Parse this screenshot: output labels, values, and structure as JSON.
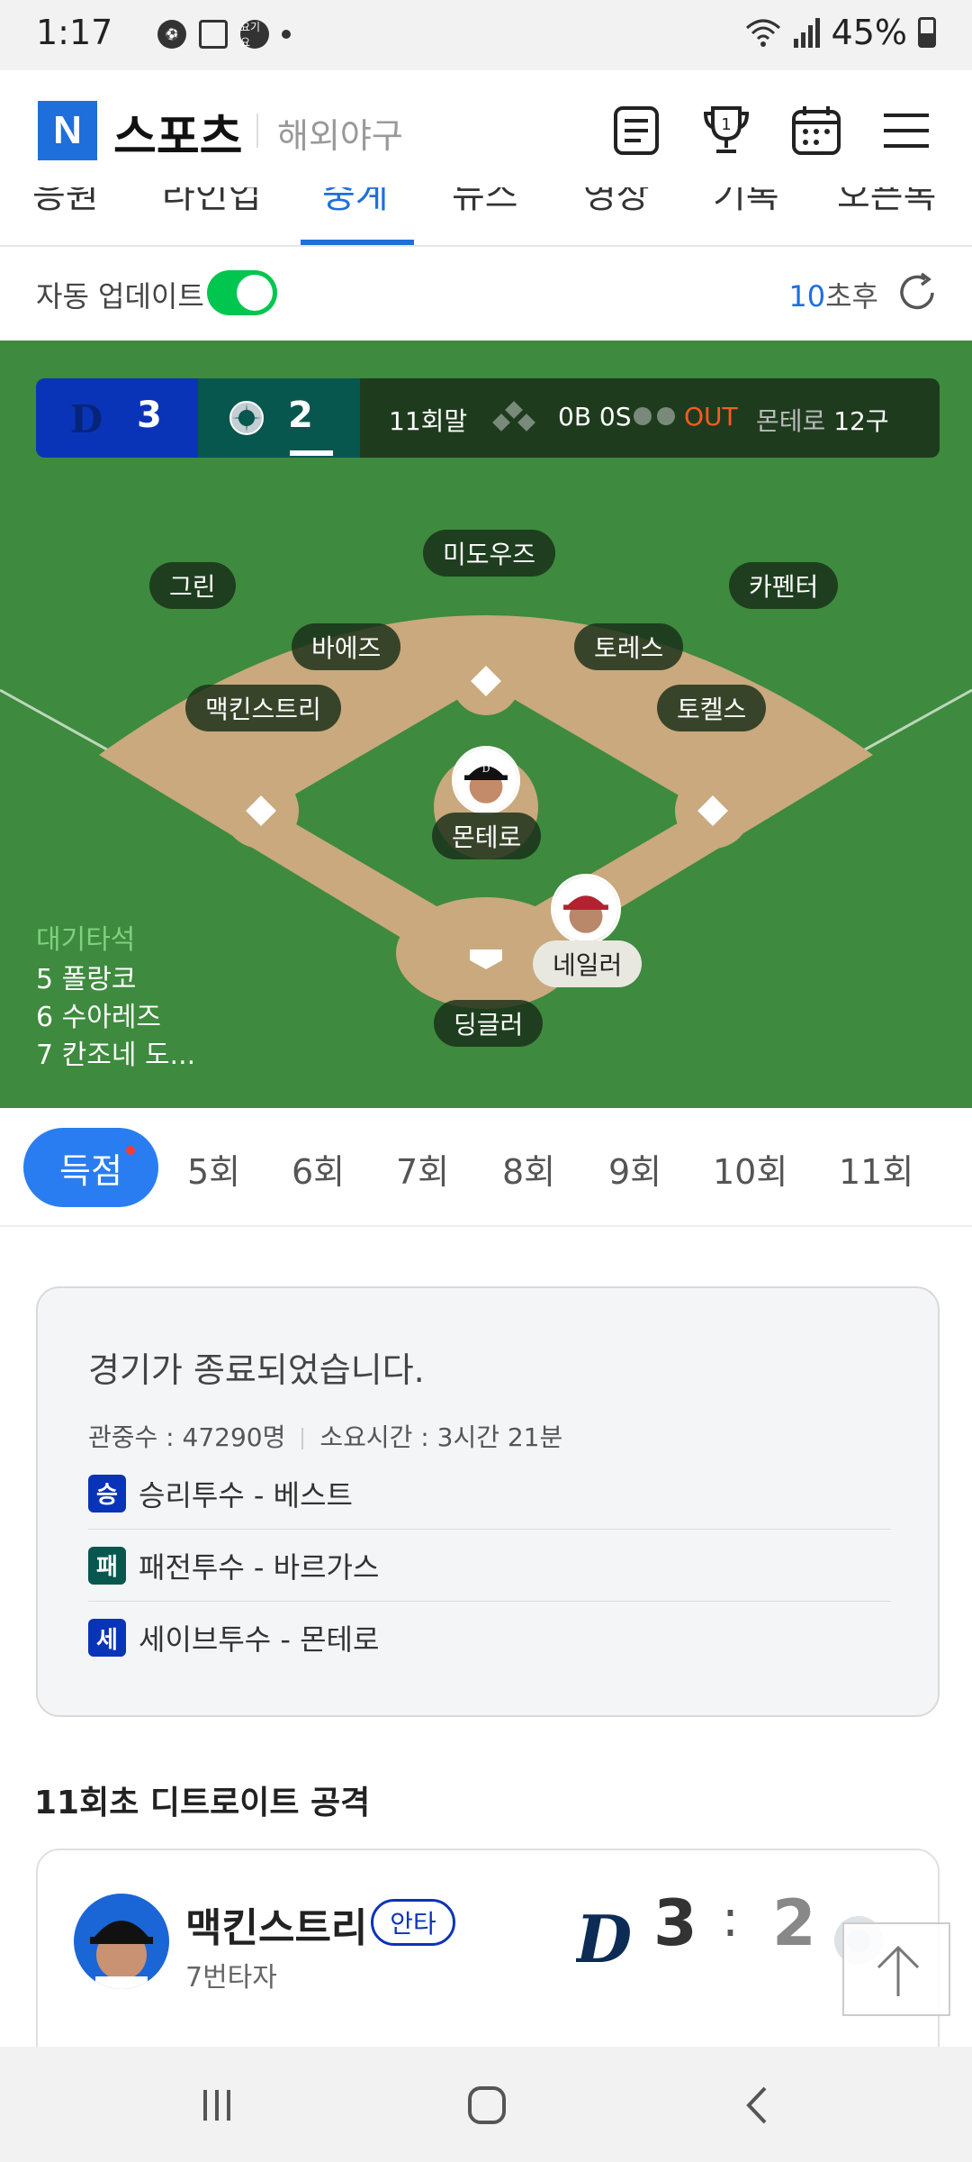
{
  "status_bar": {
    "time": "1:17",
    "notif_badge": "요기요",
    "battery": "45%"
  },
  "header": {
    "logo_letter": "N",
    "logo_text": "스포츠",
    "section": "해외야구"
  },
  "tabs": [
    {
      "label": "응원"
    },
    {
      "label": "라인업"
    },
    {
      "label": "중계",
      "active": true
    },
    {
      "label": "뉴스"
    },
    {
      "label": "영상"
    },
    {
      "label": "기록"
    },
    {
      "label": "오픈톡"
    }
  ],
  "auto_update": {
    "label": "자동 업데이트",
    "enabled": true,
    "countdown_num": "10",
    "countdown_unit": "초후"
  },
  "scoreboard": {
    "away": {
      "team_icon": "detroit-tigers-logo-icon",
      "score": "3",
      "color": "#0a34b8"
    },
    "home": {
      "team_icon": "seattle-mariners-logo-icon",
      "score": "2",
      "color": "#07574f"
    },
    "inning": "11회말",
    "count": "0B 0S",
    "out_label": "OUT",
    "pitcher_name": "몬테로",
    "pitch_count": "12구"
  },
  "field": {
    "positions": {
      "cf": "미도우즈",
      "lf": "그린",
      "rf": "카펜터",
      "ss": "바에즈",
      "b2": "토레스",
      "b3": "맥킨스트리",
      "b1": "토켈스",
      "pitcher": "몬테로",
      "catcher": "딩글러",
      "batter": "네일러"
    },
    "bench": {
      "title": "대기타석",
      "items": [
        "5 폴랑코",
        "6 수아레즈",
        "7 칸조네 도..."
      ]
    }
  },
  "inning_tabs": {
    "active": "득점",
    "items": [
      "5회",
      "6회",
      "7회",
      "8회",
      "9회",
      "10회",
      "11회"
    ]
  },
  "game_end": {
    "title": "경기가 종료되었습니다.",
    "attendance": "관중수 : 47290명",
    "duration": "소요시간 : 3시간 21분",
    "pitchers": [
      {
        "badge": "승",
        "text": "승리투수 - 베스트",
        "color": "#0a34b8"
      },
      {
        "badge": "패",
        "text": "패전투수 - 바르가스",
        "color": "#07574f"
      },
      {
        "badge": "세",
        "text": "세이브투수 - 몬테로",
        "color": "#0a34b8"
      }
    ]
  },
  "play_section": {
    "title": "11회초 디트로이트 공격",
    "player": "맥킨스트리",
    "result": "안타",
    "order": "7번타자",
    "away_score": "3",
    "home_score": "2",
    "colon": ":"
  },
  "colors": {
    "accent": "#1e6fdc",
    "field": "#3e8a3e",
    "dirt": "#c9a97d",
    "out": "#ff5a1f",
    "toggle_on": "#00c64f"
  }
}
